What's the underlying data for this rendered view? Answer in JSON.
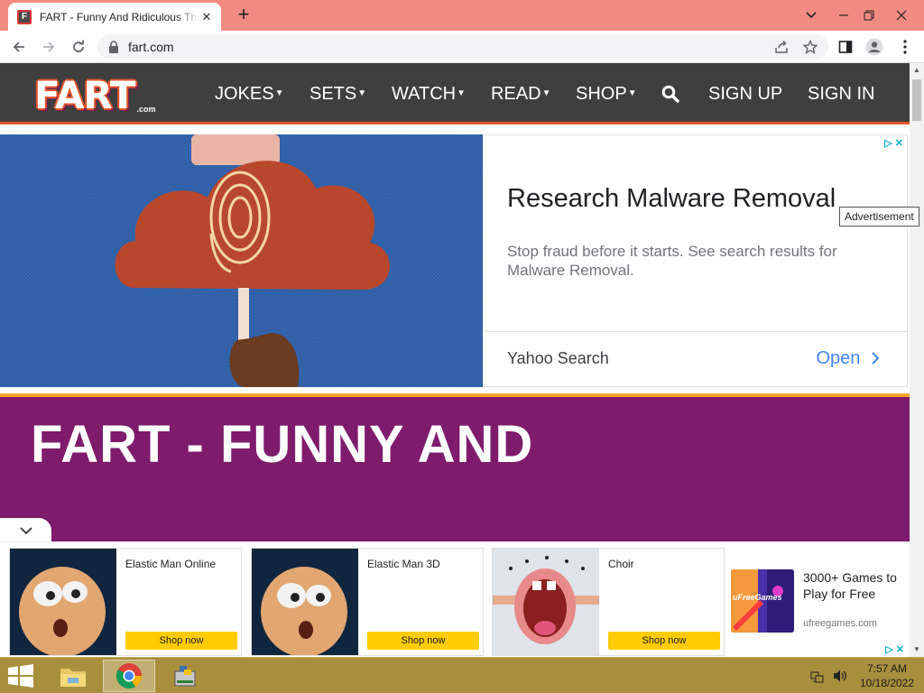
{
  "browser": {
    "tab_title": "FART - Funny And Ridiculous Thi",
    "tab_favicon": "F",
    "url": "fart.com",
    "new_tab_symbol": "+",
    "close_symbol": "✕"
  },
  "site": {
    "logo_text": "FART",
    "logo_tld": ".com",
    "menu": [
      {
        "label": "JOKES",
        "dropdown": true
      },
      {
        "label": "SETS",
        "dropdown": true
      },
      {
        "label": "WATCH",
        "dropdown": true
      },
      {
        "label": "READ",
        "dropdown": true
      },
      {
        "label": "SHOP",
        "dropdown": true
      }
    ],
    "sign_up": "SIGN UP",
    "sign_in": "SIGN IN",
    "accent_color": "#e8562c",
    "nav_bg": "#3f3f3f"
  },
  "ad": {
    "headline": "Research Malware Removal",
    "description": "Stop fraud before it starts. See search results for Malware Removal.",
    "source": "Yahoo Search",
    "cta": "Open",
    "tooltip": "Advertisement"
  },
  "hero": {
    "title": "FART - FUNNY AND",
    "bg_color": "#7e1b6d"
  },
  "bottom_ads": {
    "cards": [
      {
        "title": "Elastic Man Online",
        "button": "Shop now"
      },
      {
        "title": "Elastic Man 3D",
        "button": "Shop now"
      },
      {
        "title": "Choir",
        "button": "Shop now"
      }
    ],
    "promo": {
      "text": "3000+ Games to Play for Free",
      "domain": "ufreegames.com",
      "image_label": "uFreeGames"
    }
  },
  "taskbar": {
    "time": "7:57 AM",
    "date": "10/18/2022"
  }
}
